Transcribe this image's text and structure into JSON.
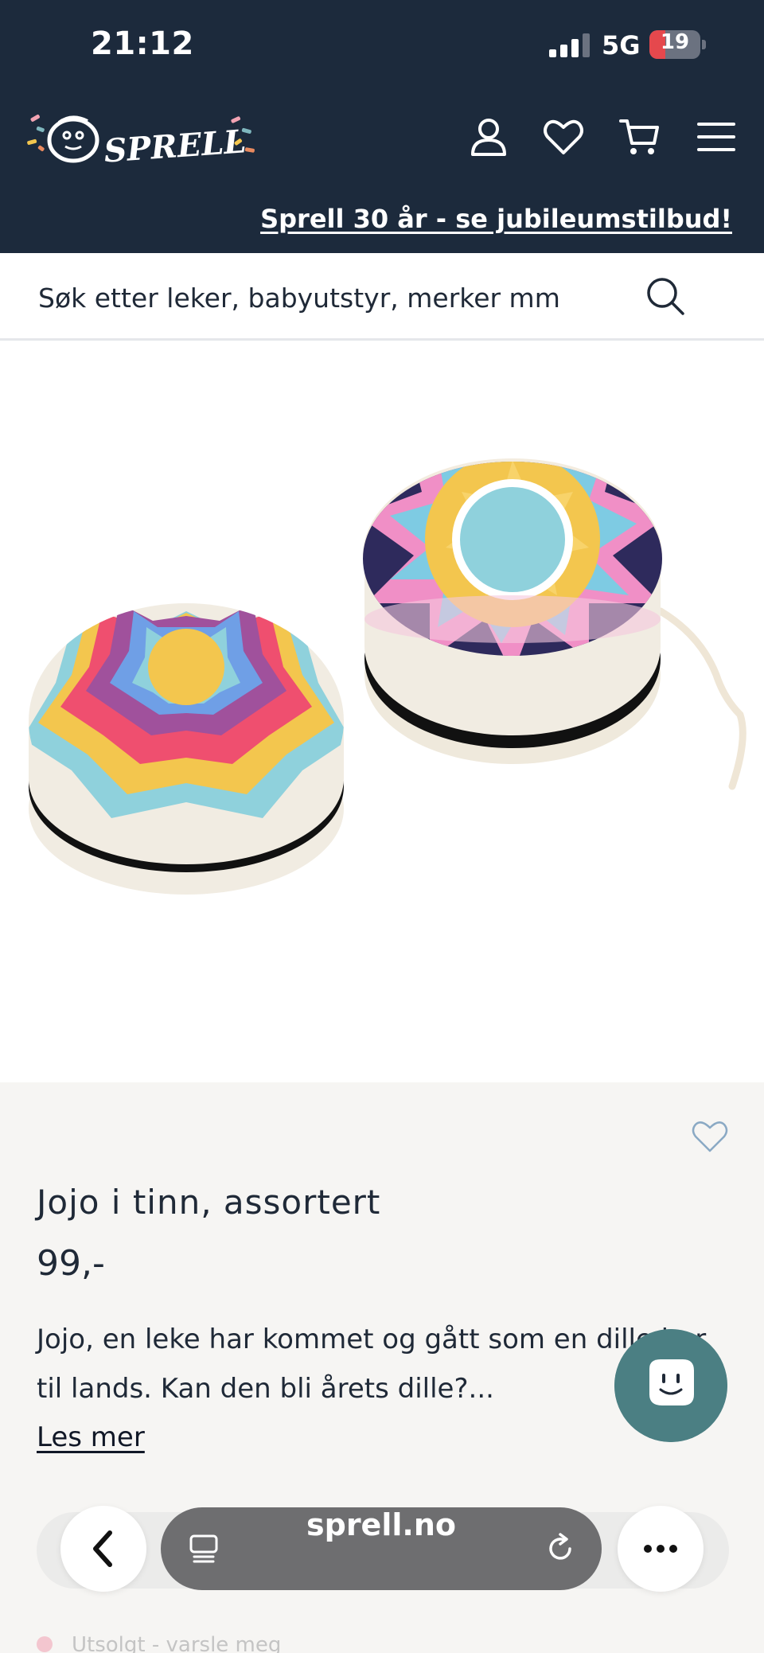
{
  "status_bar": {
    "time": "21:12",
    "network": "5G",
    "battery": "19",
    "battery_level": 0.19
  },
  "header": {
    "logo_text": "SPRELL",
    "promo_link": "Sprell 30 år - se jubileumstilbud!",
    "icons": [
      "account-icon",
      "heart-icon",
      "cart-icon",
      "menu-icon"
    ]
  },
  "search": {
    "placeholder": "Søk etter leker, babyutstyr, merker mm"
  },
  "product": {
    "title": "Jojo i tinn, assortert",
    "price": "99,-",
    "description": "Jojo, en leke har kommet og gått som en dille her til lands. Kan den bli årets dille?...",
    "read_more": "Les mer",
    "stock_status": "Utsolgt - varsle meg"
  },
  "browser": {
    "url": "sprell.no"
  },
  "colors": {
    "header_bg": "#1c2a3c",
    "info_bg": "#f6f5f3",
    "chat_bubble": "#4b7f83"
  }
}
